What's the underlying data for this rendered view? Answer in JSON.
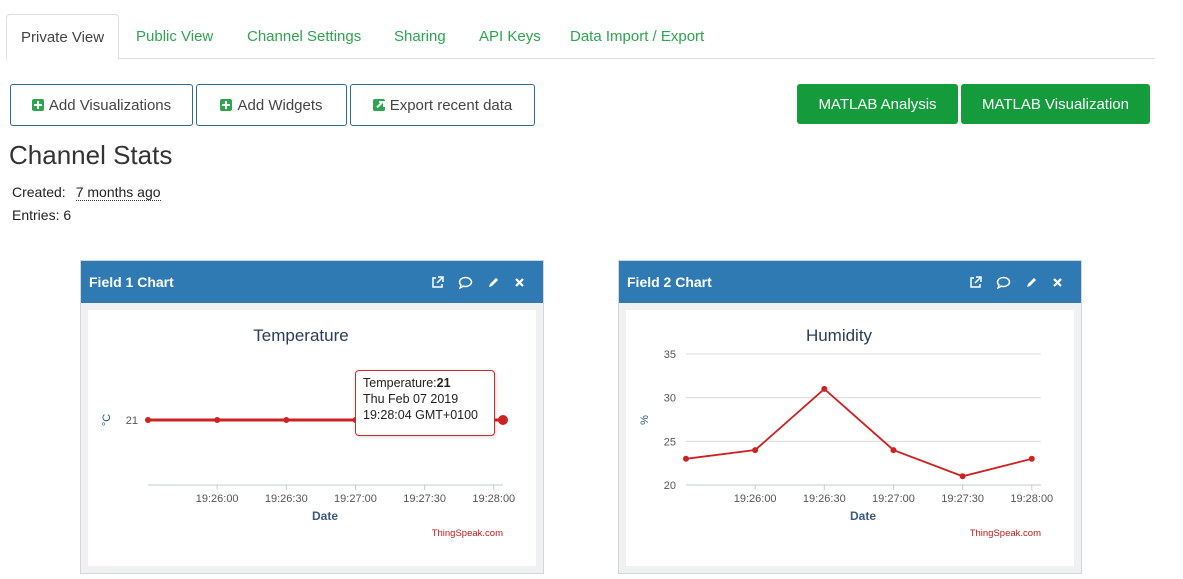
{
  "tabs": [
    {
      "label": "Private View",
      "active": true
    },
    {
      "label": "Public View"
    },
    {
      "label": "Channel Settings"
    },
    {
      "label": "Sharing"
    },
    {
      "label": "API Keys"
    },
    {
      "label": "Data Import / Export"
    }
  ],
  "toolbar": {
    "add_visualizations": "Add Visualizations",
    "add_widgets": "Add Widgets",
    "export_recent": "Export recent data",
    "matlab_analysis": "MATLAB Analysis",
    "matlab_visualization": "MATLAB Visualization"
  },
  "stats": {
    "title": "Channel Stats",
    "created_label": "Created:",
    "created_value": "7 months ago",
    "entries_label": "Entries:",
    "entries_value": "6"
  },
  "colors": {
    "accent_green": "#2ea44f",
    "panel_header": "#2f7ab3",
    "series_red": "#cc2222"
  },
  "charts": {
    "field1": {
      "panel_title": "Field 1 Chart",
      "tooltip": {
        "label": "Temperature:",
        "value": "21",
        "date": "Thu Feb 07 2019",
        "time": "19:28:04 GMT+0100"
      },
      "watermark": "ThingSpeak.com"
    },
    "field2": {
      "panel_title": "Field 2 Chart",
      "watermark": "ThingSpeak.com"
    }
  },
  "chart_data": [
    {
      "type": "line",
      "title": "Temperature",
      "xlabel": "Date",
      "ylabel": "°C",
      "x": [
        "19:25:30",
        "19:26:00",
        "19:26:30",
        "19:27:00",
        "19:27:30",
        "19:28:04"
      ],
      "series": [
        {
          "values": [
            21,
            21,
            21,
            21,
            21,
            21
          ]
        }
      ],
      "x_ticks": [
        "19:26:00",
        "19:26:30",
        "19:27:00",
        "19:27:30",
        "19:28:00"
      ],
      "y_ticks": [
        "21"
      ],
      "grid": false
    },
    {
      "type": "line",
      "title": "Humidity",
      "xlabel": "Date",
      "ylabel": "%",
      "x": [
        "19:25:30",
        "19:26:00",
        "19:26:30",
        "19:27:00",
        "19:27:30",
        "19:28:00"
      ],
      "series": [
        {
          "values": [
            23,
            24,
            31,
            24,
            21,
            23
          ]
        }
      ],
      "x_ticks": [
        "19:26:00",
        "19:26:30",
        "19:27:00",
        "19:27:30",
        "19:28:00"
      ],
      "y_ticks": [
        "20",
        "25",
        "30",
        "35"
      ],
      "ylim": [
        20,
        35
      ],
      "grid": true
    }
  ]
}
